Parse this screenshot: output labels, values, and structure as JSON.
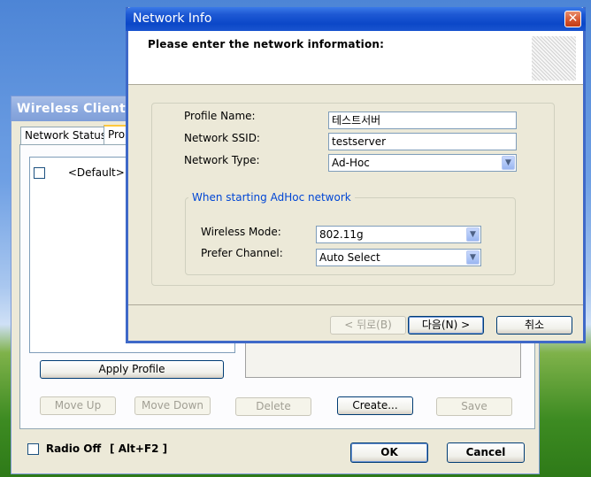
{
  "background_window": {
    "title": "Wireless Client C",
    "tabs": [
      "Network Status",
      "Pro"
    ],
    "list_items": [
      {
        "label": "<Default>"
      }
    ],
    "apply_profile": "Apply Profile",
    "move_up": "Move Up",
    "move_down": "Move Down",
    "delete": "Delete",
    "create": "Create...",
    "save": "Save",
    "radio_off": "Radio Off",
    "radio_off_shortcut": "[ Alt+F2 ]",
    "ok": "OK",
    "cancel": "Cancel"
  },
  "dialog": {
    "title": "Network Info",
    "close_glyph": "✕",
    "header": "Please enter the network information:",
    "profile_name_label": "Profile Name:",
    "profile_name_value": "테스트서버",
    "ssid_label": "Network SSID:",
    "ssid_value": "testserver",
    "network_type_label": "Network Type:",
    "network_type_value": "Ad-Hoc",
    "adhoc_group": "When starting AdHoc network",
    "wireless_mode_label": "Wireless Mode:",
    "wireless_mode_value": "802.11g",
    "prefer_channel_label": "Prefer Channel:",
    "prefer_channel_value": "Auto Select",
    "back_label": "< 뒤로(B)",
    "next_label": "다음(N) >",
    "cancel_label": "취소"
  },
  "colors": {
    "title_bar": "#0b47c8",
    "group_legend": "#0046d5",
    "dialog_bg": "#ece9d8"
  }
}
